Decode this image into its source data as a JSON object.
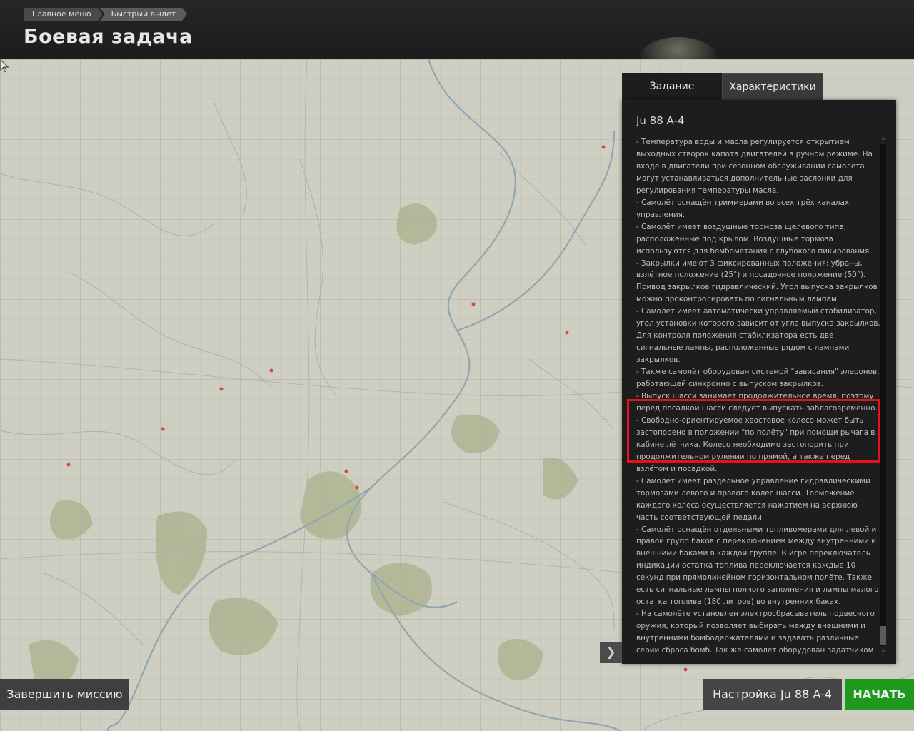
{
  "header": {
    "breadcrumb": [
      "Главное меню",
      "Быстрый вылет"
    ],
    "title": "Боевая задача"
  },
  "tabs": [
    {
      "label": "Задание",
      "active": true
    },
    {
      "label": "Характеристики",
      "active": false
    }
  ],
  "panel": {
    "aircraft": "Ju 88 A-4",
    "description": [
      "- Температура воды и масла регулируется открытием выходных створок капота двигателей в ручном режиме. На входе в двигатели при сезонном обслуживании самолёта могут устанавливаться дополнительные заслонки для регулирования температуры масла.",
      "- Самолёт оснащён триммерами во всех трёх каналах управления.",
      "- Самолёт имеет воздушные тормоза щелевого типа, расположенные под крылом. Воздушные тормоза используются для бомбометания с глубокого пикирования.",
      "- Закрылки имеют 3 фиксированных положения: убраны, взлётное положение (25°) и посадочное положение (50°). Привод закрылков гидравлический. Угол выпуска закрылков можно проконтролировать по сигнальным лампам.",
      "- Самолёт имеет автоматически управляемый стабилизатор, угол установки которого зависит от угла выпуска закрылков. Для контроля положения стабилизатора есть две сигнальные лампы, расположенные рядом с лампами закрылков.",
      "- Также самолёт оборудован системой \"зависания\" элеронов, работающей синхронно с выпуском закрылков.",
      "- Выпуск шасси занимает продолжительное время, поэтому перед посадкой шасси следует выпускать заблаговременно.",
      "- Свободно-ориентируемое хвостовое колесо может быть застопорено в положении \"по полёту\" при помощи рычага в кабине лётчика. Колесо необходимо застопорить при продолжительном рулении по прямой, а также перед взлётом и посадкой.",
      "- Самолёт имеет раздельное управление гидравлическими тормозами левого и правого колёс шасси. Торможение каждого колеса осуществляется нажатием на верхнюю часть соответствующей педали.",
      "- Самолёт оснащён отдельными топливомерами для левой и правой групп баков с переключением между внутренними и внешними баками в каждой группе. В игре переключатель индикации остатка топлива переключается каждые 10 секунд при прямолинейном горизонтальном полёте. Также есть сигнальные лампы полного заполнения и лампы малого остатка топлива (180 литров) во внутренних баках.",
      "- На самолёте установлен электросбрасыватель подвесного оружия, который позволяет выбирать между внешними и внутренними бомбодержателями и задавать различные серии сброса бомб. Так же самолет оборудован задатчиком интервала между сбросом бомб в серии."
    ],
    "scroll_position": 0.96
  },
  "buttons": {
    "end_mission": "Завершить миссию",
    "setup": "Настройка Ju 88 A-4",
    "start": "НАЧАТЬ"
  },
  "icons": {
    "collapse": "chevron-right-icon",
    "scroll_up": "chevron-up-icon",
    "scroll_down": "chevron-down-icon"
  },
  "colors": {
    "start_button": "#1d9a1d",
    "highlight": "#e8101c",
    "panel_bg": "#1d1d1d"
  }
}
